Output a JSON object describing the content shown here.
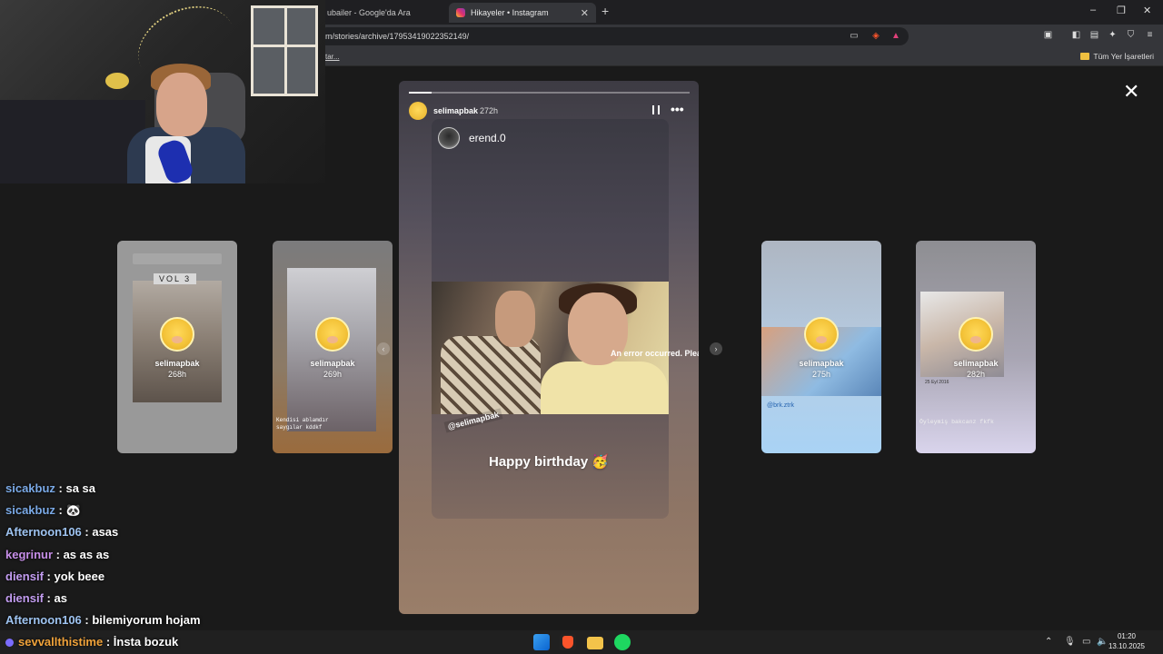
{
  "browser": {
    "tabs": [
      {
        "label": "ubailer - Google'da Ara"
      },
      {
        "label": "Hikayeler • Instagram",
        "close": "✕"
      }
    ],
    "new_tab": "+",
    "window_controls": {
      "minimize": "–",
      "restore": "❐",
      "close": "✕"
    },
    "url": "m/stories/archive/17953419022352149/",
    "bookmarks_left": "tar...",
    "bookmarks_folder": "Tüm Yer İşaretleri"
  },
  "story": {
    "close_label": "✕",
    "progress": 0.08,
    "username": "selimapbak",
    "time": "272h",
    "more": "•••",
    "reposted_username": "erend.0",
    "error_text": "An error occurred. Plea",
    "mention": "@selimapbak",
    "caption": "Happy birthday 🥳"
  },
  "side_stories": [
    {
      "username": "selimapbak",
      "time": "268h",
      "overlay": "VOL 3"
    },
    {
      "username": "selimapbak",
      "time": "269h",
      "overlay": "Kendisi ablamdır\nsaygılar kddkf"
    },
    {
      "username": "selimapbak",
      "time": "275h",
      "overlay": "@brk.ztrk"
    },
    {
      "username": "selimapbak",
      "time": "282h",
      "overlay": "Öyleymiş bakcanz fkfk",
      "date": "25 Eyl 2016"
    }
  ],
  "chat": [
    {
      "user": "sicakbuz",
      "message": " : sa sa",
      "color": "#7aa9e6"
    },
    {
      "user": "sicakbuz",
      "message": " : 🐼",
      "color": "#7aa9e6"
    },
    {
      "user": "Afternoon106",
      "message": " : asas",
      "color": "#9ec3f0"
    },
    {
      "user": "kegrinur",
      "message": " : as as as",
      "color": "#c68ee8"
    },
    {
      "user": "diensif",
      "message": " : yok beee",
      "color": "#c29cf0"
    },
    {
      "user": "diensif",
      "message": " : as",
      "color": "#c29cf0"
    },
    {
      "user": "Afternoon106",
      "message": " : bilemiyorum hojam",
      "color": "#9ec3f0"
    },
    {
      "user": "sevvallthistime",
      "message": " : İnsta bozuk",
      "color": "#f0a23a"
    }
  ],
  "taskbar": {
    "time": "01:20",
    "date": "13.10.2025"
  }
}
